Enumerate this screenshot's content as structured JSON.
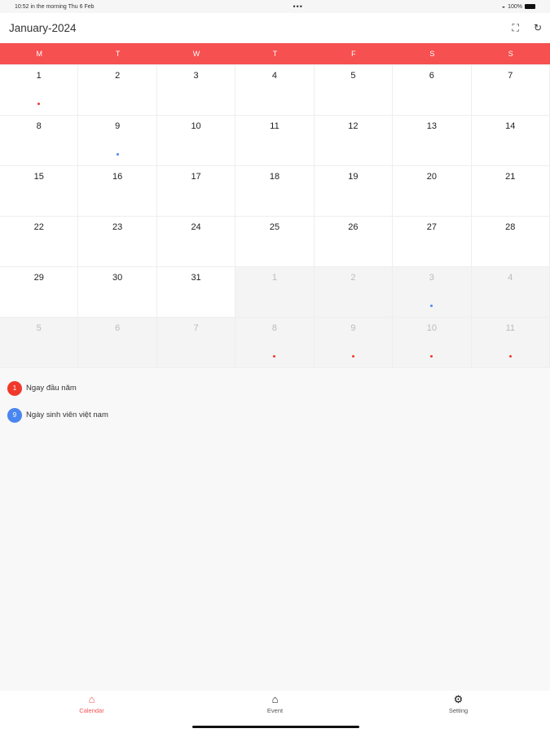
{
  "status": {
    "time": "10:52 in the morning  Thu 6 Feb",
    "dots": "•••",
    "battery": "100%"
  },
  "header": {
    "title": "January-2024"
  },
  "weekdays": [
    "M",
    "T",
    "W",
    "T",
    "F",
    "S",
    "S"
  ],
  "colors": {
    "accent": "#f65050",
    "red": "#f0392b",
    "blue": "#4a86f0"
  },
  "days": [
    {
      "d": "1",
      "dot": "red"
    },
    {
      "d": "2"
    },
    {
      "d": "3"
    },
    {
      "d": "4"
    },
    {
      "d": "5"
    },
    {
      "d": "6"
    },
    {
      "d": "7"
    },
    {
      "d": "8"
    },
    {
      "d": "9",
      "dot": "blue"
    },
    {
      "d": "10"
    },
    {
      "d": "11"
    },
    {
      "d": "12"
    },
    {
      "d": "13"
    },
    {
      "d": "14"
    },
    {
      "d": "15"
    },
    {
      "d": "16"
    },
    {
      "d": "17"
    },
    {
      "d": "18"
    },
    {
      "d": "19"
    },
    {
      "d": "20"
    },
    {
      "d": "21"
    },
    {
      "d": "22"
    },
    {
      "d": "23"
    },
    {
      "d": "24"
    },
    {
      "d": "25"
    },
    {
      "d": "26"
    },
    {
      "d": "27"
    },
    {
      "d": "28"
    },
    {
      "d": "29"
    },
    {
      "d": "30"
    },
    {
      "d": "31"
    },
    {
      "d": "1",
      "other": true
    },
    {
      "d": "2",
      "other": true
    },
    {
      "d": "3",
      "other": true,
      "dot": "blue"
    },
    {
      "d": "4",
      "other": true
    },
    {
      "d": "5",
      "other": true
    },
    {
      "d": "6",
      "other": true
    },
    {
      "d": "7",
      "other": true
    },
    {
      "d": "8",
      "other": true,
      "dot": "red"
    },
    {
      "d": "9",
      "other": true,
      "dot": "red"
    },
    {
      "d": "10",
      "other": true,
      "dot": "red"
    },
    {
      "d": "11",
      "other": true,
      "dot": "red"
    }
  ],
  "legend": [
    {
      "badge": "1",
      "label": "Ngay đầu năm",
      "color": "red"
    },
    {
      "badge": "9",
      "label": "Ngày sinh viên việt nam",
      "color": "blue"
    }
  ],
  "nav": [
    {
      "label": "Calendar",
      "icon": "home-icon"
    },
    {
      "label": "Event",
      "icon": "home-icon"
    },
    {
      "label": "Setting",
      "icon": "gear-icon"
    }
  ]
}
